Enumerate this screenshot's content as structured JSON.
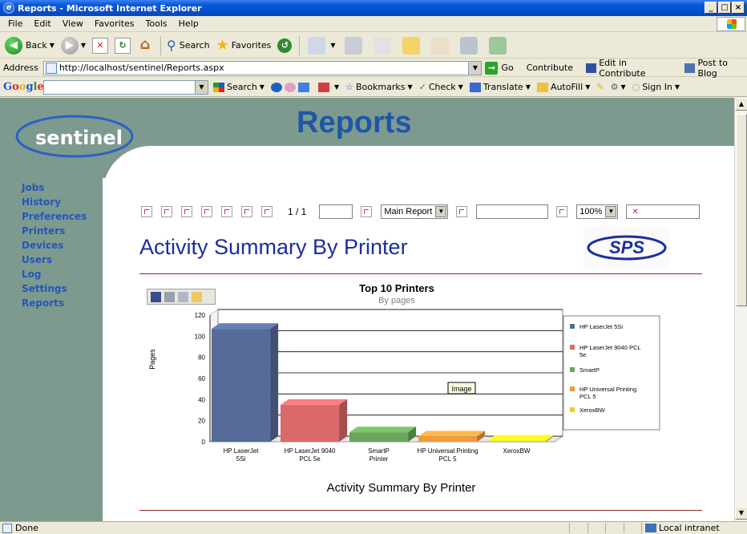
{
  "window": {
    "title": "Reports - Microsoft Internet Explorer",
    "buttons": [
      "_",
      "□",
      "×"
    ]
  },
  "menu": [
    "File",
    "Edit",
    "View",
    "Favorites",
    "Tools",
    "Help"
  ],
  "toolbar": {
    "back": "Back",
    "search": "Search",
    "favorites": "Favorites"
  },
  "address": {
    "label": "Address",
    "url": "http://localhost/sentinel/Reports.aspx",
    "go": "Go",
    "links": [
      "Contribute",
      "Edit in Contribute",
      "Post to Blog"
    ]
  },
  "google": {
    "logo": "Google",
    "items": [
      "Search",
      "Bookmarks",
      "Check",
      "Translate",
      "AutoFill",
      "Sign In"
    ]
  },
  "page": {
    "logo_text": "sentinel",
    "heading": "Reports",
    "nav": [
      "Jobs",
      "History",
      "Preferences",
      "Printers",
      "Devices",
      "Users",
      "Log",
      "Settings",
      "Reports"
    ]
  },
  "report_toolbar": {
    "pager": "1 / 1",
    "report_select": "Main Report",
    "zoom": "100%"
  },
  "report": {
    "title": "Activity Summary By Printer",
    "sps_logo": "SPS",
    "footer_title": "Activity Summary By Printer"
  },
  "chart_data": {
    "type": "bar",
    "title": "Top 10 Printers",
    "subtitle": "By pages",
    "ylabel": "Pages",
    "ylim": [
      0,
      120
    ],
    "yticks": [
      0,
      20,
      40,
      60,
      80,
      100,
      120
    ],
    "categories": [
      "HP LaserJet 5Si",
      "HP LaserJet 9040 PCL 5e",
      "SmartP Printer",
      "HP Universal Printing PCL 5",
      "XeroxBW"
    ],
    "values": [
      107,
      35,
      9,
      5,
      1
    ],
    "colors": [
      "#566b99",
      "#d9696a",
      "#6aa65a",
      "#f39a3c",
      "#e6d21a"
    ],
    "legend": [
      "HP LaserJet 5Si",
      "HP LaserJet 9040 PCL 5e",
      "SmartP",
      "HP Universal Printing PCL 5",
      "XeroxBW"
    ],
    "legend_position": "right",
    "tooltip": "Image",
    "grid": true
  },
  "status": {
    "text": "Done",
    "zone": "Local intranet"
  }
}
